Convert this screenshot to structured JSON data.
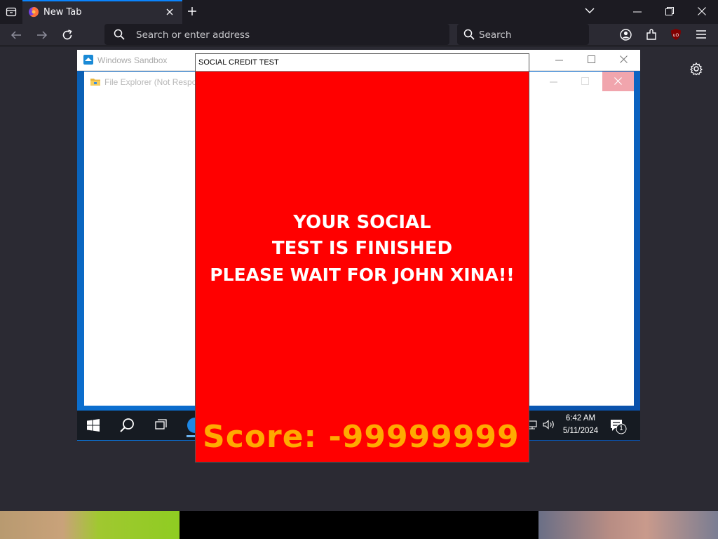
{
  "browser": {
    "tab_title": "New Tab",
    "address_placeholder": "Search or enter address",
    "search_placeholder": "Search"
  },
  "sandbox": {
    "title": "Windows Sandbox",
    "explorer_title": "File Explorer (Not Respo",
    "clock_time": "6:42 AM",
    "clock_date": "5/11/2024",
    "notification_count": "1"
  },
  "social_window": {
    "title": "SOCIAL CREDIT TEST",
    "message_line1": "YOUR SOCIAL",
    "message_line2": "TEST IS FINISHED",
    "message_line3": "PLEASE WAIT FOR JOHN XINA!!",
    "score": "Score: -99999999",
    "background_color": "#ff0000",
    "score_color": "#ffaa00"
  },
  "icons": {
    "tab_list": "tab-list-icon",
    "firefox": "firefox-icon",
    "close_tab": "close-icon",
    "new_tab": "plus-icon",
    "back": "back-arrow-icon",
    "forward": "forward-arrow-icon",
    "reload": "reload-icon",
    "account": "account-icon",
    "extensions": "extensions-icon",
    "ublock": "ublock-icon",
    "menu": "hamburger-menu-icon",
    "settings": "gear-icon"
  }
}
